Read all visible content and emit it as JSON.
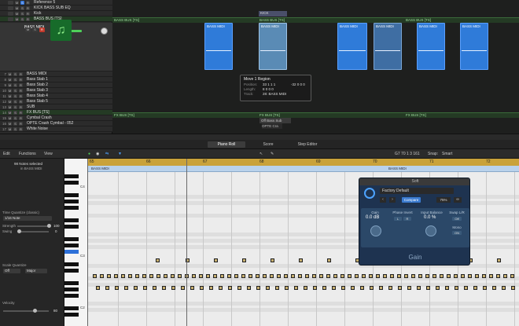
{
  "tracks": {
    "headers": [
      {
        "num": "",
        "name": "Reference 5"
      },
      {
        "num": "",
        "name": "KICK BASS SUB EQ"
      },
      {
        "num": "",
        "name": "Kick"
      },
      {
        "num": "",
        "name": "BASS BUS [TS]"
      }
    ],
    "selected": {
      "name": "BASS MIDI"
    },
    "lower": [
      {
        "num": "7",
        "name": "BASS MIDI"
      },
      {
        "num": "8",
        "name": "Bass Stab 1"
      },
      {
        "num": "9",
        "name": "Bass Stab 2"
      },
      {
        "num": "10",
        "name": "Bass Stab 3"
      },
      {
        "num": "11",
        "name": "Bass Stab 4"
      },
      {
        "num": "12",
        "name": "Bass Stab 5"
      },
      {
        "num": "13",
        "name": "SUB"
      },
      {
        "num": "14",
        "name": "FX BUS [TS]"
      },
      {
        "num": "15",
        "name": "Cymbal Crash"
      },
      {
        "num": "16",
        "name": "OPTE Crash Cymbal - 052"
      },
      {
        "num": "17",
        "name": "White Noise"
      }
    ],
    "bus_labels": {
      "bass_bus": "BASS BUS [TS]",
      "fx_bus": "FX BUS [TS]"
    },
    "kick_region": "KICK",
    "region_label": "BASS MIDI",
    "off_sub": "Off Bass Sub",
    "opte": "OPTE Cra"
  },
  "tooltip": {
    "title": "Move 1 Region",
    "rows": [
      {
        "k": "Position:",
        "v": "33 1 1 1",
        "v2": "-32 0 0 0"
      },
      {
        "k": "Length:",
        "v": "8 0 0 0",
        "v2": ""
      },
      {
        "k": "Track:",
        "v": "28: BASS MIDI",
        "v2": ""
      }
    ]
  },
  "tabs": [
    "Piano Roll",
    "Score",
    "Step Editor"
  ],
  "editbar": {
    "edit": "Edit",
    "functions": "Functions",
    "view": "View",
    "position": "G7  70 1 3 161",
    "snap_label": "Snap:",
    "snap_value": "Smart"
  },
  "inspector": {
    "selected": "98 Notes selected",
    "sub": "in BASS MIDI",
    "tq_label": "Time Quantize (classic)",
    "tq_value": "1/16 Note",
    "strength_label": "Strength",
    "strength_value": "100",
    "swing_label": "Swing",
    "swing_value": "0",
    "sq_label": "Scale Quantize",
    "sq_off": "Off",
    "sq_major": "Major",
    "velocity_label": "Velocity",
    "velocity_value": "80"
  },
  "keys": [
    "C4",
    "C3",
    "C2"
  ],
  "ruler": {
    "marks": [
      "65",
      "66",
      "67",
      "68",
      "69",
      "70",
      "71",
      "72"
    ]
  },
  "region_bar": {
    "left": "BASS MIDI",
    "right": "BASS MIDI"
  },
  "plugin": {
    "title": "Soft",
    "preset": "Factory Default",
    "compare": "Compare",
    "percent": "75%",
    "gain_label": "Gain",
    "gain_value": "0.0 dB",
    "phase_label": "Phase Invert",
    "phase_l": "L",
    "phase_r": "R",
    "balance_label": "Input Balance",
    "balance_value": "0.0 %",
    "swap_label": "Swap L/R",
    "swap_value": "Off",
    "mono_label": "Mono",
    "mono_value": "ON",
    "footer": "Gain"
  },
  "colors": {
    "region": "#2f7bd9",
    "bus": "#243a24",
    "ruler": "#c9a23a",
    "note": "#c8b070",
    "plugin": "#1e3350"
  }
}
